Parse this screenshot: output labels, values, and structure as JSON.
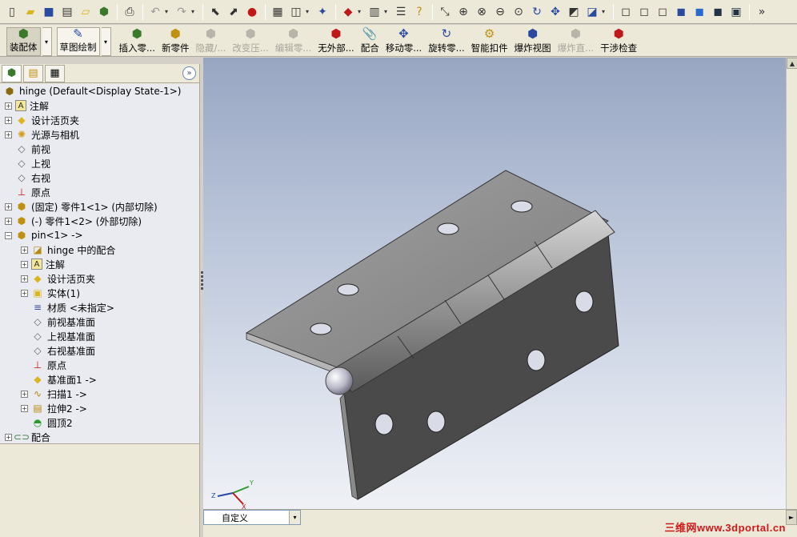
{
  "toolbar": {
    "icons": [
      "new-icon",
      "open-icon",
      "save-icon",
      "print-preview-icon",
      "open-folder-icon",
      "options-icon",
      "print-icon",
      "undo-icon",
      "redo-icon",
      "select-icon",
      "smart-select-icon",
      "traffic-light-icon",
      "grid-icon",
      "view-orient-icon",
      "rotate-icon",
      "appearance-icon",
      "display-pane-icon",
      "help-icon",
      "zoom-fit-icon",
      "zoom-area-icon",
      "zoom-select-icon",
      "zoom-in-icon",
      "zoom-prev-icon",
      "rotate-view-icon",
      "pan-icon",
      "section-icon",
      "display-style-icon",
      "wireframe-icon",
      "hidden-lines-icon",
      "shaded-icon",
      "shaded-edges-icon",
      "perspective-icon"
    ]
  },
  "command_manager": {
    "assembly": "装配体",
    "sketch": "草图绘制",
    "buttons": [
      {
        "label": "插入零...",
        "enabled": true
      },
      {
        "label": "新零件",
        "enabled": true
      },
      {
        "label": "隐藏/...",
        "enabled": false
      },
      {
        "label": "改变压...",
        "enabled": false
      },
      {
        "label": "编辑零...",
        "enabled": false
      },
      {
        "label": "无外部...",
        "enabled": true
      },
      {
        "label": "配合",
        "enabled": true
      },
      {
        "label": "移动零...",
        "enabled": true
      },
      {
        "label": "旋转零...",
        "enabled": true
      },
      {
        "label": "智能扣件",
        "enabled": true
      },
      {
        "label": "爆炸视图",
        "enabled": true
      },
      {
        "label": "爆炸直...",
        "enabled": false
      },
      {
        "label": "干涉检查",
        "enabled": true
      }
    ]
  },
  "feature_tree": {
    "root": "hinge  (Default<Display State-1>)",
    "nodes": [
      {
        "label": "注解",
        "icon": "annotation-icon",
        "level": 0
      },
      {
        "label": "设计活页夹",
        "icon": "design-binder-icon",
        "level": 0
      },
      {
        "label": "光源与相机",
        "icon": "lights-cameras-icon",
        "level": 0
      },
      {
        "label": "前视",
        "icon": "plane-icon",
        "level": 0
      },
      {
        "label": "上视",
        "icon": "plane-icon",
        "level": 0
      },
      {
        "label": "右视",
        "icon": "plane-icon",
        "level": 0
      },
      {
        "label": "原点",
        "icon": "origin-icon",
        "level": 0
      },
      {
        "label": "(固定) 零件1<1> (内部切除)",
        "icon": "part-icon",
        "level": 0
      },
      {
        "label": "(-) 零件1<2> (外部切除)",
        "icon": "part-icon",
        "level": 0
      },
      {
        "label": "pin<1> ->",
        "icon": "part-icon",
        "level": 0
      },
      {
        "label": "hinge 中的配合",
        "icon": "mates-folder-icon",
        "level": 1
      },
      {
        "label": "注解",
        "icon": "annotation-icon",
        "level": 1
      },
      {
        "label": "设计活页夹",
        "icon": "design-binder-icon",
        "level": 1
      },
      {
        "label": "实体(1)",
        "icon": "solid-bodies-icon",
        "level": 1
      },
      {
        "label": "材质 <未指定>",
        "icon": "material-icon",
        "level": 1
      },
      {
        "label": "前视基准面",
        "icon": "plane-icon",
        "level": 1
      },
      {
        "label": "上视基准面",
        "icon": "plane-icon",
        "level": 1
      },
      {
        "label": "右视基准面",
        "icon": "plane-icon",
        "level": 1
      },
      {
        "label": "原点",
        "icon": "origin-icon",
        "level": 1
      },
      {
        "label": "基准面1 ->",
        "icon": "datum-plane-icon",
        "level": 1
      },
      {
        "label": "扫描1 ->",
        "icon": "sweep-icon",
        "level": 1
      },
      {
        "label": "拉伸2 ->",
        "icon": "extrude-icon",
        "level": 1
      },
      {
        "label": "圆顶2",
        "icon": "dome-icon",
        "level": 1
      },
      {
        "label": "配合",
        "icon": "mates-icon",
        "level": 0
      }
    ]
  },
  "viewport": {
    "view_name": "自定义",
    "watermark": "三维网www.3dportal.cn",
    "axes": {
      "x": "X",
      "y": "Y",
      "z": "Z"
    }
  }
}
